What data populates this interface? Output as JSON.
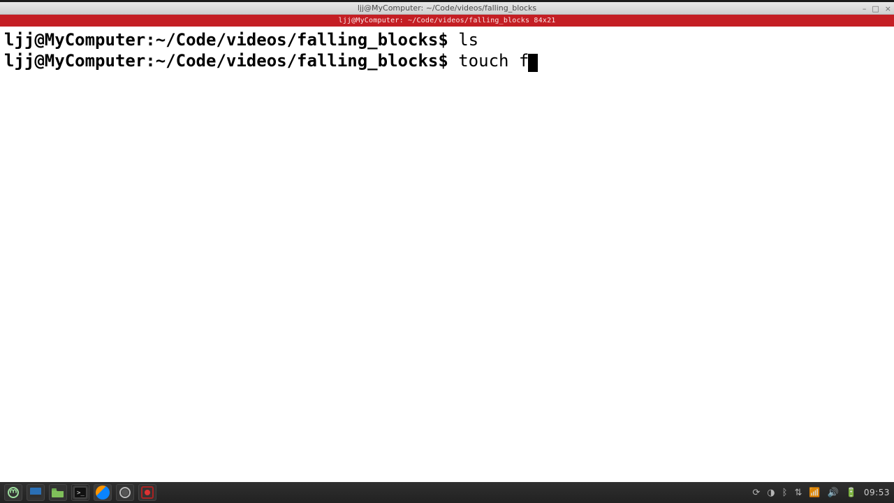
{
  "window": {
    "title": "ljj@MyComputer: ~/Code/videos/falling_blocks",
    "controls": {
      "minimize": "–",
      "maximize": "□",
      "close": "×"
    }
  },
  "tabbar": {
    "label": "ljj@MyComputer: ~/Code/videos/falling_blocks 84x21"
  },
  "terminal": {
    "lines": [
      {
        "user": "ljj@MyComputer",
        "sep": ":",
        "path": "~/Code/videos/falling_blocks",
        "dollar": "$ ",
        "cmd": "ls"
      },
      {
        "user": "ljj@MyComputer",
        "sep": ":",
        "path": "~/Code/videos/falling_blocks",
        "dollar": "$ ",
        "cmd": "touch f"
      }
    ]
  },
  "taskbar": {
    "items": [
      "menu",
      "show-desktop",
      "file-manager",
      "terminal",
      "firefox",
      "obs",
      "screen-recorder"
    ],
    "clock": "09:53"
  },
  "colors": {
    "tabbar": "#c41e24",
    "termbg": "#ffffff",
    "termfg": "#000000"
  }
}
